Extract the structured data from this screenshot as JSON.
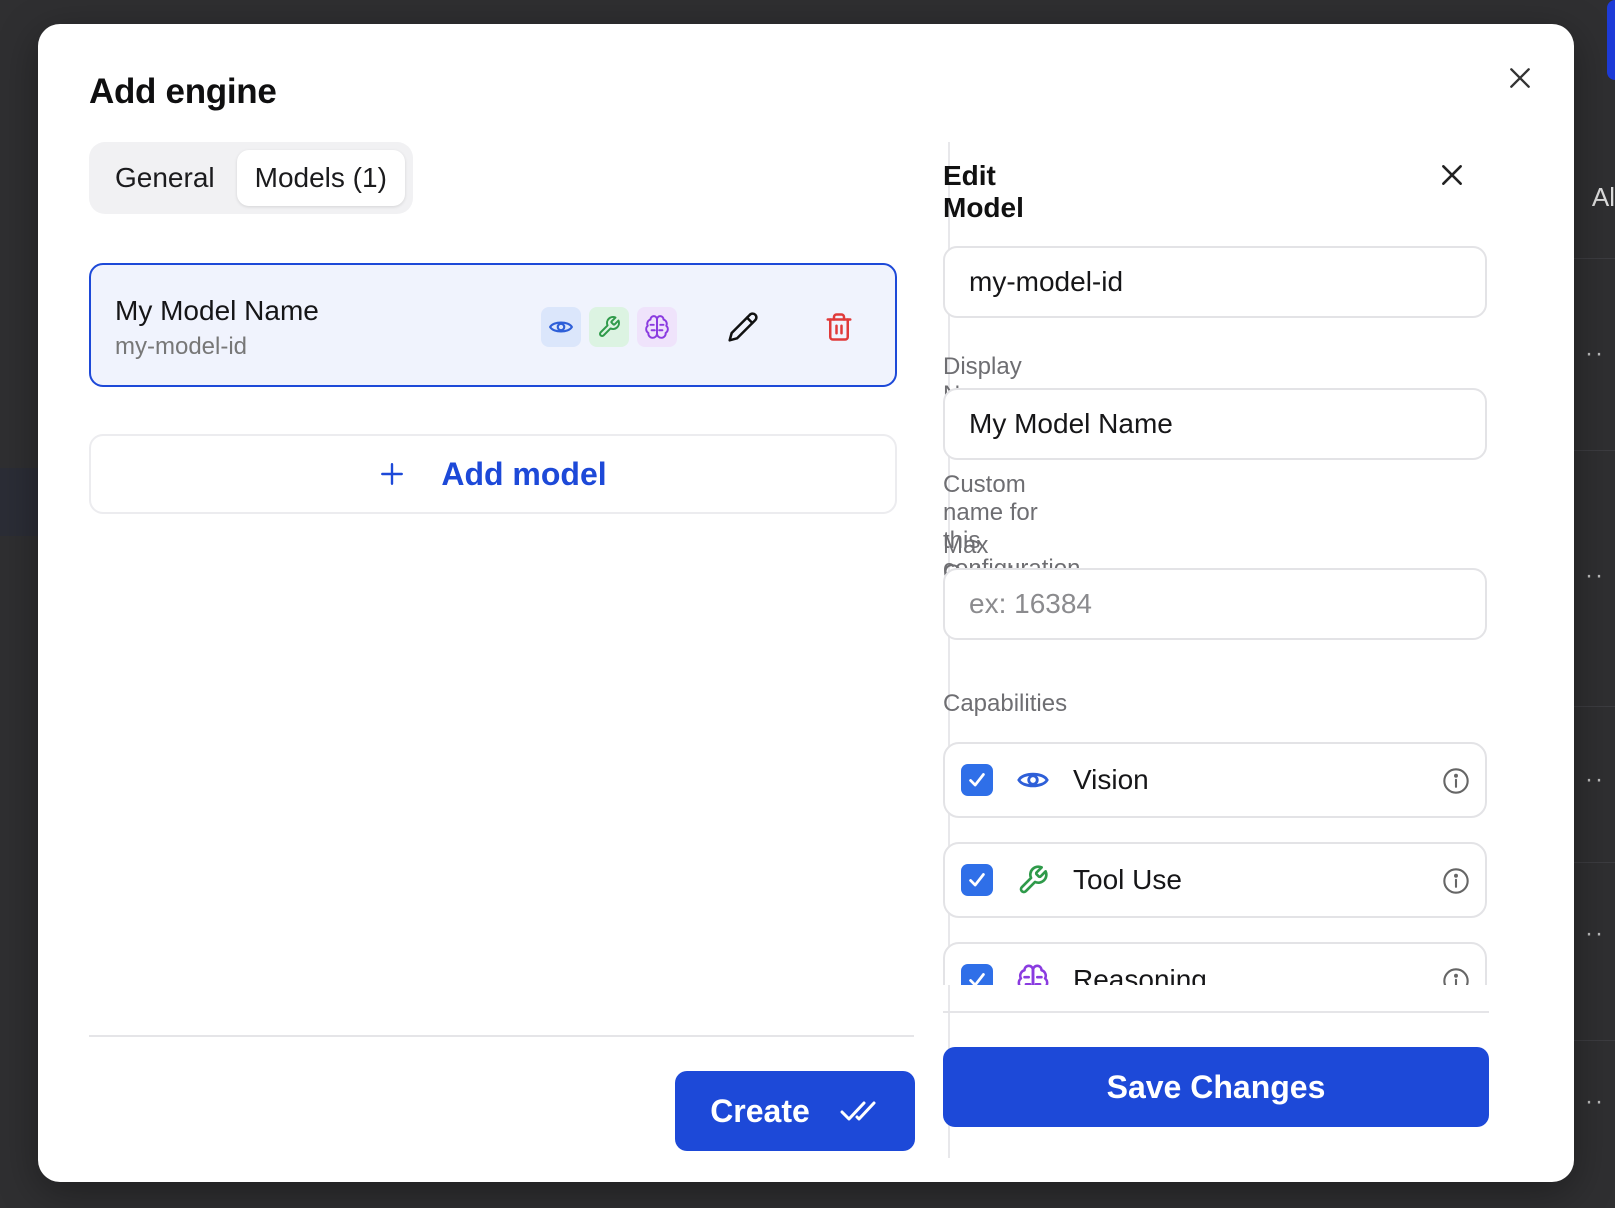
{
  "dialog": {
    "title": "Add engine",
    "tabs": [
      {
        "label": "General",
        "active": false
      },
      {
        "label": "Models (1)",
        "active": true
      }
    ]
  },
  "models": [
    {
      "name": "My Model Name",
      "id": "my-model-id",
      "capability_icons": [
        "eye-icon",
        "wrench-icon",
        "brain-icon"
      ],
      "action_icons": [
        "pencil-icon",
        "trash-icon"
      ]
    }
  ],
  "add_model_label": "Add model",
  "create_label": "Create",
  "edit_panel": {
    "title": "Edit Model",
    "model_id_value": "my-model-id",
    "display_name_label": "Display Name *",
    "display_name_value": "My Model Name",
    "display_name_help": "Custom name for this configuration",
    "max_tokens_label": "Max Output Tokens",
    "max_tokens_placeholder": "ex: 16384",
    "max_tokens_value": "",
    "capabilities_label": "Capabilities",
    "capabilities": [
      {
        "label": "Vision",
        "checked": true,
        "icon": "eye-icon"
      },
      {
        "label": "Tool Use",
        "checked": true,
        "icon": "wrench-icon"
      },
      {
        "label": "Reasoning",
        "checked": true,
        "icon": "brain-icon"
      }
    ],
    "save_label": "Save Changes"
  },
  "colors": {
    "accent": "#1d49d8",
    "checkbox": "#2f6fe8",
    "vision": "#2e5fd8",
    "tool": "#2f9a4a",
    "reasoning": "#8a3be0",
    "danger": "#e03a3a"
  }
}
